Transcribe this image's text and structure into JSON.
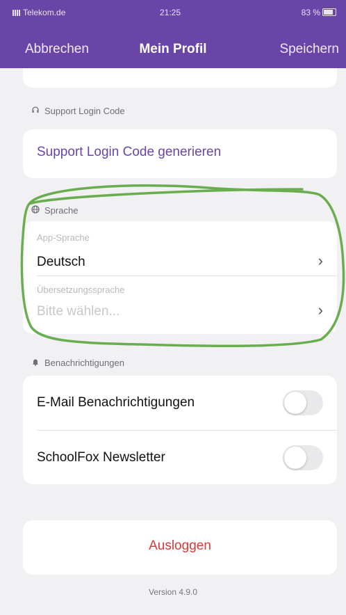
{
  "status_bar": {
    "carrier": "Telekom.de",
    "time": "21:25",
    "right": "83 %"
  },
  "nav": {
    "cancel_label": "Abbrechen",
    "title": "Mein Profil",
    "save_label": "Speichern"
  },
  "support": {
    "section_label": "Support Login Code",
    "action_label": "Support Login Code generieren"
  },
  "language": {
    "section_label": "Sprache",
    "app_language_label": "App-Sprache",
    "app_language_value": "Deutsch",
    "translation_label": "Übersetzungssprache",
    "translation_placeholder": "Bitte wählen..."
  },
  "notifications": {
    "section_label": "Benachrichtigungen",
    "items": [
      {
        "label": "E-Mail Benachrichtigungen",
        "enabled": false
      },
      {
        "label": "SchoolFox Newsletter",
        "enabled": false
      }
    ]
  },
  "logout_label": "Ausloggen",
  "version": "Version 4.9.0",
  "colors": {
    "accent": "#6a45a8",
    "destructive": "#d33a3a",
    "annotation": "#5aa63c"
  },
  "icons": [
    "headset-icon",
    "globe-icon",
    "bell-icon",
    "chevron-right-icon"
  ]
}
